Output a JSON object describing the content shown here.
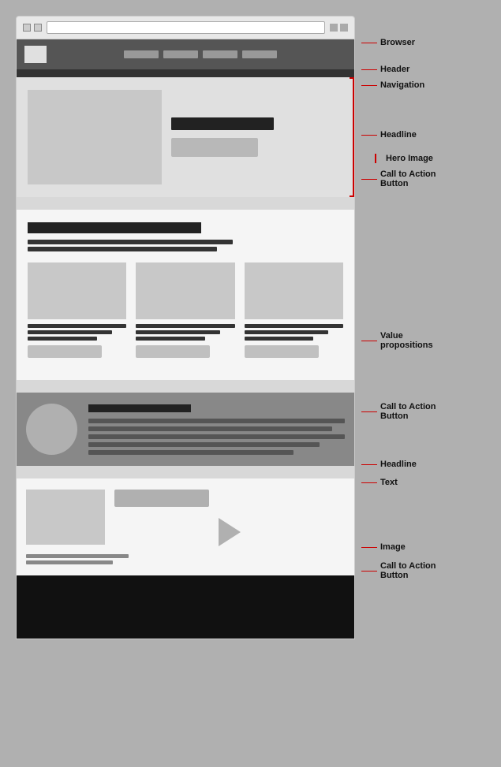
{
  "browser": {
    "label": "Browser",
    "address_bar_placeholder": ""
  },
  "labels": {
    "browser": "Browser",
    "header": "Header",
    "navigation": "Navigation",
    "headline": "Headline",
    "hero_image": "Hero Image",
    "cta_button": "Call to Action Button",
    "value_props": "Value propositions",
    "vp_cta": "Call to Action Button",
    "testimonial_headline": "Headline",
    "testimonial_text": "Text",
    "bottom_image": "Image",
    "bottom_cta": "Call to Action Button"
  },
  "sections": {
    "hero": {
      "has_headline": true,
      "has_cta": true
    },
    "value_props": {
      "card_count": 3
    },
    "testimonial": {
      "text_line_count": 5
    },
    "bottom": {}
  }
}
